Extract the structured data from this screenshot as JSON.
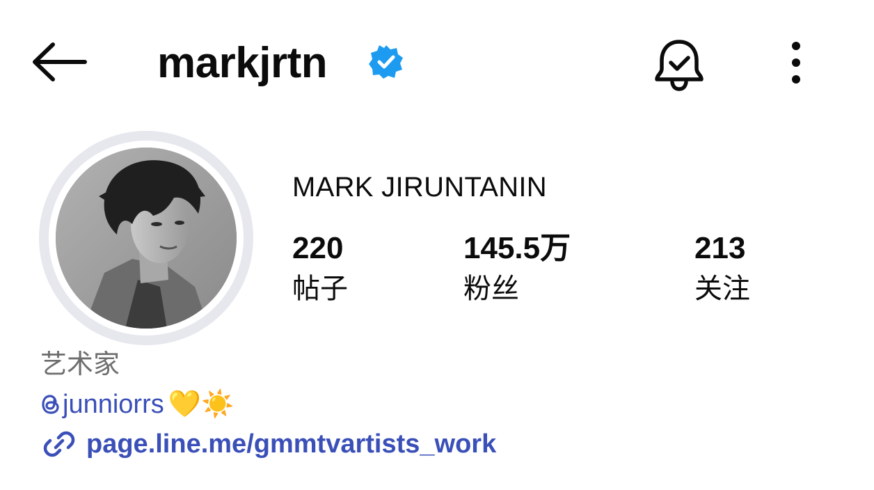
{
  "header": {
    "username": "markjrtn",
    "icons": {
      "back": "back-arrow-icon",
      "verified": "verified-badge-icon",
      "notifications": "bell-check-icon",
      "more": "more-vertical-icon"
    }
  },
  "profile": {
    "full_name": "MARK JIRUNTANIN",
    "stats": {
      "posts": {
        "value": "220",
        "label": "帖子"
      },
      "followers": {
        "value": "145.5万",
        "label": "粉丝"
      },
      "following": {
        "value": "213",
        "label": "关注"
      }
    },
    "bio": {
      "category": "艺术家",
      "threads_handle": "junniorrs",
      "threads_emojis": "💛☀️",
      "link": "page.line.me/gmmtvartists_work"
    }
  },
  "colors": {
    "verified_blue": "#1d9bf0",
    "link_blue": "#3a4fb8",
    "category_gray": "#6e6e6e",
    "avatar_ring": "#e6e8ee"
  }
}
